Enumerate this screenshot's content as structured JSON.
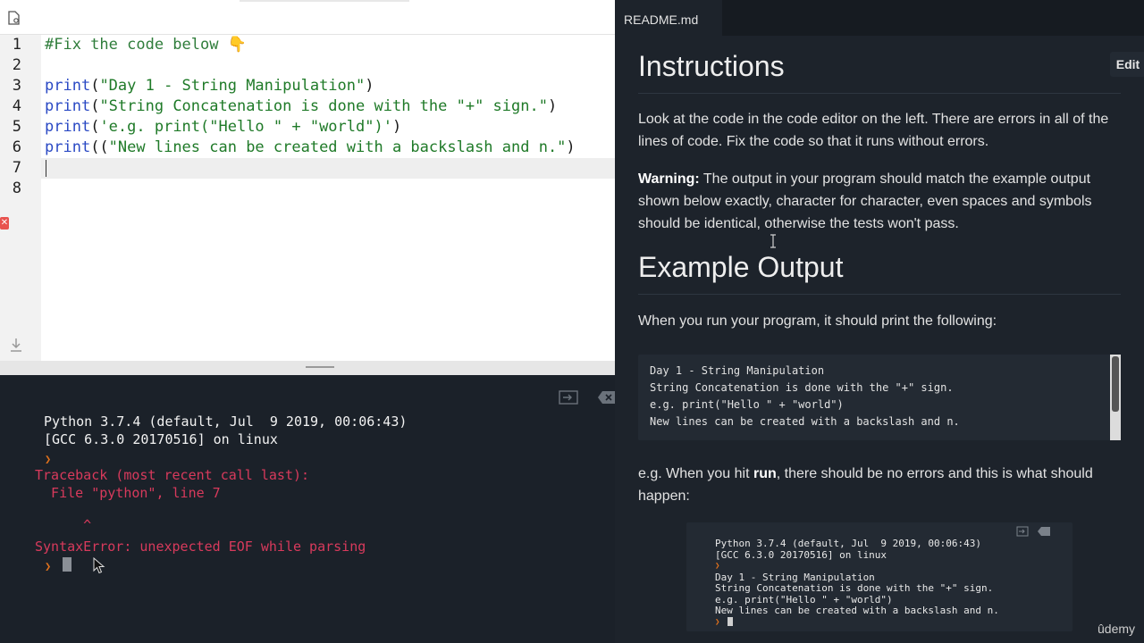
{
  "editor": {
    "line_numbers": [
      "1",
      "2",
      "3",
      "4",
      "5",
      "6",
      "7",
      "8"
    ],
    "lines": [
      {
        "segments": [
          {
            "t": "#Fix the code below 👇",
            "c": "comment"
          }
        ]
      },
      {
        "segments": []
      },
      {
        "segments": [
          {
            "t": "print",
            "c": "kw"
          },
          {
            "t": "(",
            "c": "plain"
          },
          {
            "t": "\"Day 1 - String Manipulation\"",
            "c": "str"
          },
          {
            "t": ")",
            "c": "plain"
          }
        ]
      },
      {
        "segments": [
          {
            "t": "print",
            "c": "kw"
          },
          {
            "t": "(",
            "c": "plain"
          },
          {
            "t": "\"String Concatenation is done with the \"+\" sign.\"",
            "c": "str"
          },
          {
            "t": ")",
            "c": "plain"
          }
        ]
      },
      {
        "segments": [
          {
            "t": "print",
            "c": "kw"
          },
          {
            "t": "(",
            "c": "plain"
          },
          {
            "t": "'e.g. print(\"Hello \" + \"world\")'",
            "c": "str"
          },
          {
            "t": ")",
            "c": "plain"
          }
        ]
      },
      {
        "segments": [
          {
            "t": "print",
            "c": "kw"
          },
          {
            "t": "((",
            "c": "plain"
          },
          {
            "t": "\"New lines can be created with a backslash and n.\"",
            "c": "str"
          },
          {
            "t": ")",
            "c": "plain"
          }
        ]
      },
      {
        "segments": []
      },
      {
        "segments": []
      }
    ],
    "colors": {
      "comment": "#2f7d3b",
      "keyword": "#2a49c4",
      "string": "#1f7a28",
      "error": "#e8534f"
    }
  },
  "console": {
    "lines": [
      {
        "text": "Python 3.7.4 (default, Jul  9 2019, 00:06:43)",
        "kind": "white"
      },
      {
        "text": "[GCC 6.3.0 20170516] on linux",
        "kind": "white"
      },
      {
        "text": "❯",
        "kind": "prompt"
      },
      {
        "text": "Traceback (most recent call last):",
        "kind": "red"
      },
      {
        "text": "  File \"python\", line 7",
        "kind": "red"
      },
      {
        "text": "",
        "kind": "red"
      },
      {
        "text": "      ^",
        "kind": "red"
      },
      {
        "text": "SyntaxError: unexpected EOF while parsing",
        "kind": "red"
      },
      {
        "text": "❯",
        "kind": "prompt"
      }
    ],
    "error_color": "#d83a5c",
    "prompt_color": "#e0711c"
  },
  "readme": {
    "tab_label": "README.md",
    "edit_label": "Edit",
    "instructions_heading": "Instructions",
    "instructions_text": "Look at the code in the code editor on the left. There are errors in all of the lines of code. Fix the code so that it runs without errors.",
    "warning_label": "Warning:",
    "warning_text": " The output in your program should match the example output shown below exactly, character for character, even spaces and symbols should be identical, otherwise the tests won't pass.",
    "example_heading": "Example Output",
    "example_intro": "When you run your program, it should print the following:",
    "example_lines": [
      "Day 1 - String Manipulation",
      "String Concatenation is done with the \"+\" sign.",
      "e.g. print(\"Hello \" + \"world\")",
      "New lines can be created with a backslash and n."
    ],
    "run_text_before": "e.g. When you hit ",
    "run_word": "run",
    "run_text_after": ", there should be no errors and this is what should happen:",
    "mini_console_lines": [
      {
        "text": "Python 3.7.4 (default, Jul  9 2019, 00:06:43)",
        "kind": "white"
      },
      {
        "text": "[GCC 6.3.0 20170516] on linux",
        "kind": "white"
      },
      {
        "text": "❯",
        "kind": "prompt"
      },
      {
        "text": "Day 1 - String Manipulation",
        "kind": "white"
      },
      {
        "text": "String Concatenation is done with the \"+\" sign.",
        "kind": "white"
      },
      {
        "text": "e.g. print(\"Hello \" + \"world\")",
        "kind": "white"
      },
      {
        "text": "New lines can be created with a backslash and n.",
        "kind": "white"
      },
      {
        "text": "❯",
        "kind": "prompt"
      }
    ]
  },
  "branding": {
    "logo_text": "ûdemy"
  }
}
